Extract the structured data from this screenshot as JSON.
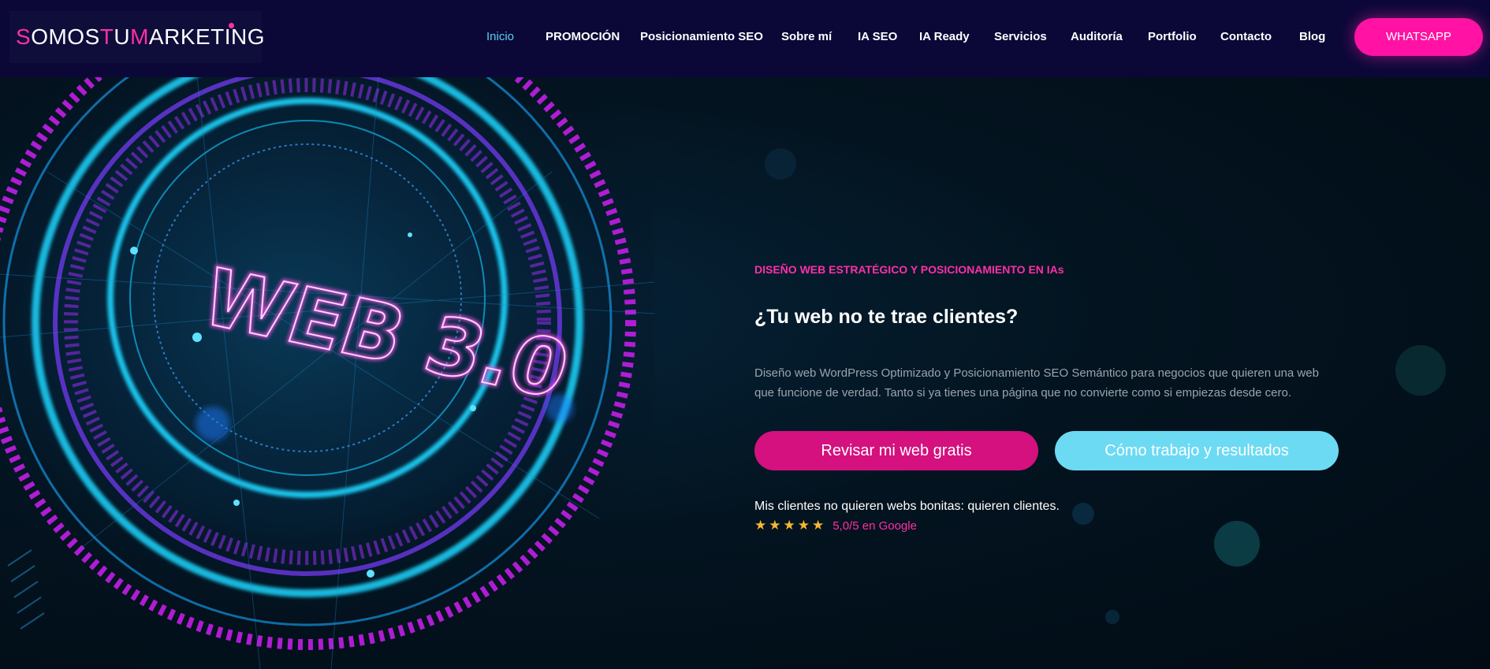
{
  "header": {
    "logo_parts": [
      "S",
      "OMOS ",
      "T",
      "U ",
      "M",
      "ARKETING"
    ],
    "nav": [
      {
        "label": "Inicio",
        "active": true
      },
      {
        "label": "PROMOCIÓN"
      },
      {
        "label": "Posicionamiento SEO"
      },
      {
        "label": "Sobre mí"
      },
      {
        "label": "IA SEO"
      },
      {
        "label": "IA Ready"
      },
      {
        "label": "Servicios"
      },
      {
        "label": "Auditoría"
      },
      {
        "label": "Portfolio"
      },
      {
        "label": "Contacto"
      },
      {
        "label": "Blog"
      }
    ],
    "cta_label": "WHATSAPP"
  },
  "hero": {
    "image_text": "WEB 3.0",
    "eyebrow": "DISEÑO WEB ESTRATÉGICO Y POSICIONAMIENTO EN IAs",
    "headline": "¿Tu web no te trae clientes?",
    "description": "Diseño web WordPress Optimizado y Posicionamiento SEO Semántico para negocios que quieren una web que funcione de verdad. Tanto si ya tienes una página que no convierte como si empiezas desde cero.",
    "primary_button": "Revisar mi web gratis",
    "secondary_button": "Cómo trabajo y resultados",
    "clients_text": "Mis clientes no quieren webs bonitas: quieren clientes.",
    "stars": "★★★★★",
    "rating": 5,
    "rating_text": "5,0/5 en Google"
  },
  "colors": {
    "header_bg": "#0b0838",
    "accent_pink": "#ff12a4",
    "accent_cyan": "#6cdaf3",
    "nav_active": "#56d3f0",
    "star": "#f7b733"
  }
}
